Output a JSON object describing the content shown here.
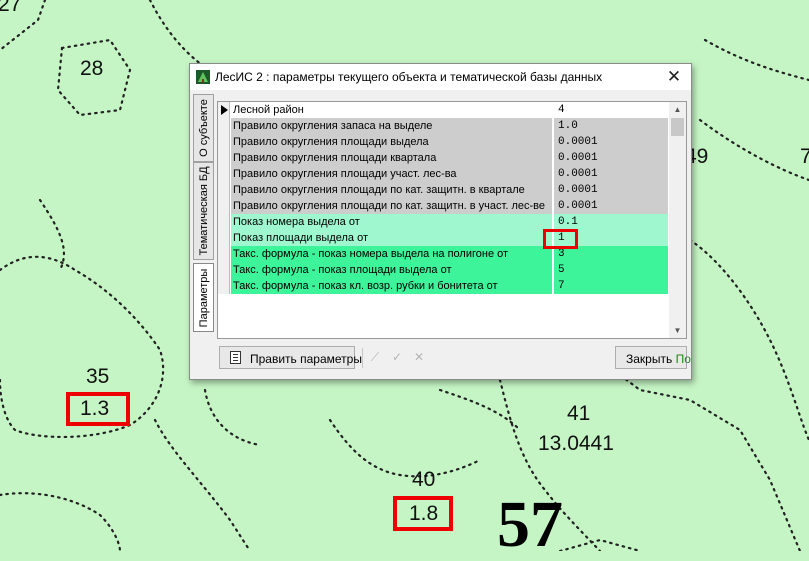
{
  "map": {
    "labels": [
      {
        "id": "27",
        "text": "27"
      },
      {
        "id": "28",
        "text": "28"
      },
      {
        "id": "49",
        "text": "49"
      },
      {
        "id": "7",
        "text": "7"
      },
      {
        "id": "35",
        "text": "35"
      },
      {
        "id": "35a",
        "text": "1.3"
      },
      {
        "id": "41",
        "text": "41"
      },
      {
        "id": "41a",
        "text": "13.0441"
      },
      {
        "id": "40",
        "text": "40"
      },
      {
        "id": "40a",
        "text": "1.8"
      },
      {
        "id": "57",
        "text": "57"
      }
    ]
  },
  "dialog": {
    "title": "ЛесИС 2 : параметры текущего объекта и тематической базы данных",
    "close_glyph": "✕",
    "tabs": [
      {
        "label": "О субъекте"
      },
      {
        "label": "Тематическая БД"
      },
      {
        "label": "Параметры"
      }
    ],
    "rows": [
      {
        "name": "Лесной район",
        "value": "4",
        "style": "white",
        "current": true
      },
      {
        "name": "Правило округления запаса на выделе",
        "value": "1.0",
        "style": "gray"
      },
      {
        "name": "Правило округления площади выдела",
        "value": "0.0001",
        "style": "gray"
      },
      {
        "name": "Правило округления площади квартала",
        "value": "0.0001",
        "style": "gray"
      },
      {
        "name": "Правило округления площади участ. лес-ва",
        "value": "0.0001",
        "style": "gray"
      },
      {
        "name": "Правило округления площади по кат. защитн. в квартале",
        "value": "0.0001",
        "style": "gray"
      },
      {
        "name": "Правило округления площади по кат. защитн. в участ. лес-ве",
        "value": "0.0001",
        "style": "gray"
      },
      {
        "name": "Показ номера выдела от",
        "value": "0.1",
        "style": "light"
      },
      {
        "name": "Показ площади выдела от",
        "value": "1",
        "style": "light"
      },
      {
        "name": "Такс. формула - показ номера выдела на полигоне от",
        "value": "3",
        "style": "bright"
      },
      {
        "name": "Такс. формула - показ площади выдела от",
        "value": "5",
        "style": "bright"
      },
      {
        "name": "Такс. формула - показ кл. возр. рубки и бонитета от",
        "value": "7",
        "style": "bright"
      }
    ],
    "toolbar": {
      "edit_label": "Править параметры",
      "close_label": "Закрыть",
      "close_suffix": "По"
    }
  },
  "colors": {
    "map_bg": "#c5f5c5",
    "highlight": "#ee0000",
    "row_gray": "#cdcdcd",
    "row_light": "#9ff7cf",
    "row_bright": "#3df49a"
  }
}
